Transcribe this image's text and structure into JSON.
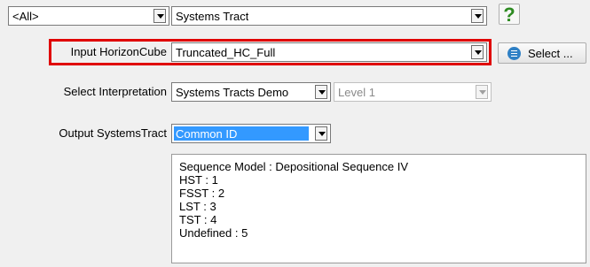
{
  "row1": {
    "filter_value": "<All>",
    "type_value": "Systems Tract",
    "help_glyph": "?",
    "help_icon": "question-mark-icon",
    "help_color": "#2e8b22"
  },
  "input_horizon": {
    "label": "Input HorizonCube",
    "value": "Truncated_HC_Full",
    "highlight_color": "#e00000",
    "select_label": "Select ...",
    "select_icon": "list-icon"
  },
  "interpretation": {
    "label": "Select Interpretation",
    "value": "Systems Tracts Demo",
    "level_value": "Level 1"
  },
  "output": {
    "label": "Output SystemsTract",
    "value": "Common ID",
    "selected_color": "#3399ff"
  },
  "info_lines": [
    "Sequence Model : Depositional Sequence IV",
    "HST : 1",
    "FSST : 2",
    "LST : 3",
    "TST : 4",
    "Undefined : 5"
  ]
}
